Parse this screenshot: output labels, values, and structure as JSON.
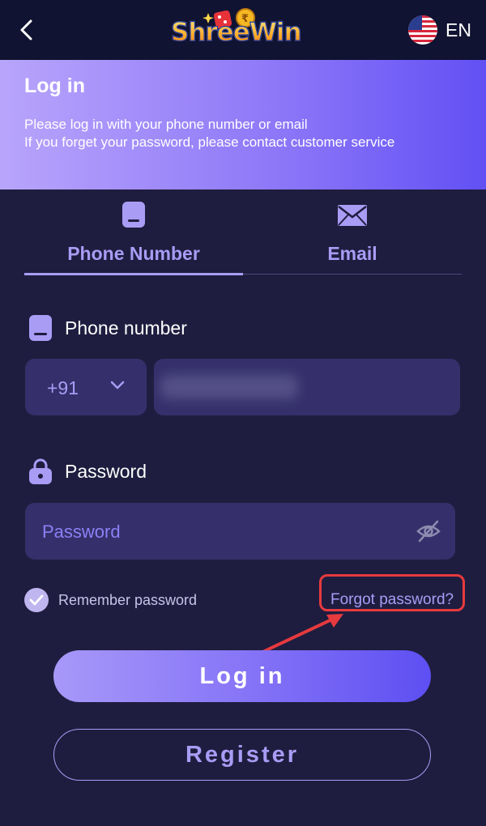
{
  "colors": {
    "background": "#1f1d3f",
    "topbar": "#101331",
    "accent": "#a99cf5",
    "field": "#35306b",
    "annotation": "#e63a3e"
  },
  "topbar": {
    "back_icon": "chevron-left-icon",
    "logo_text": "ShreeWin",
    "language_flag": "us-flag-icon",
    "language": "EN"
  },
  "header": {
    "title": "Log in",
    "line1": "Please log in with your phone number or email",
    "line2": "If you forget your password, please contact customer service"
  },
  "tabs": [
    {
      "label": "Phone Number",
      "icon": "phone-icon",
      "active": true
    },
    {
      "label": "Email",
      "icon": "envelope-icon",
      "active": false
    }
  ],
  "phone": {
    "label": "Phone number",
    "icon": "phone-icon",
    "country_code": "+91",
    "dropdown_icon": "chevron-down-icon"
  },
  "password": {
    "label": "Password",
    "icon": "lock-icon",
    "placeholder": "Password",
    "toggle_icon": "eye-slash-icon"
  },
  "remember": {
    "label": "Remember password",
    "checked": true
  },
  "forgot": {
    "label": "Forgot password?"
  },
  "buttons": {
    "login": "Log in",
    "register": "Register"
  }
}
